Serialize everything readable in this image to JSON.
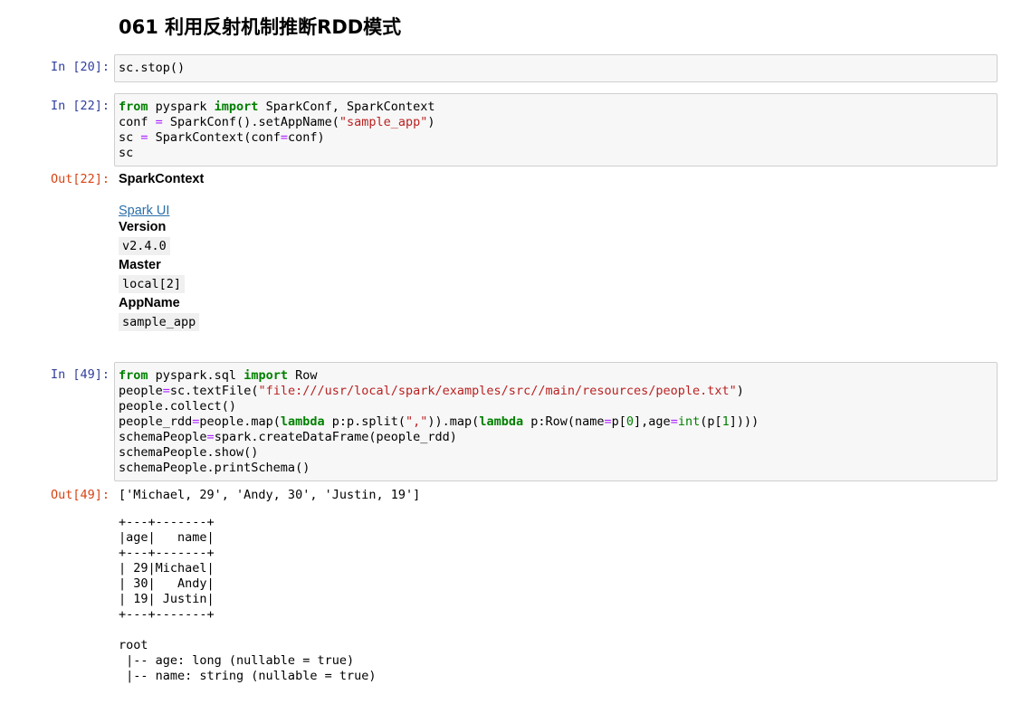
{
  "notebook": {
    "title": "061 利用反射机制推断RDD模式"
  },
  "cells": [
    {
      "prompt": "In [20]:",
      "code": "sc.stop()"
    },
    {
      "prompt": "In [22]:",
      "code_lines": [
        "from pyspark import SparkConf, SparkContext",
        "conf = SparkConf().setAppName(\"sample_app\")",
        "sc = SparkContext(conf=conf)",
        "sc"
      ],
      "out_prompt": "Out[22]:",
      "output": {
        "heading": "SparkContext",
        "link": "Spark UI",
        "version_label": "Version",
        "version_value": "v2.4.0",
        "master_label": "Master",
        "master_value": "local[2]",
        "appname_label": "AppName",
        "appname_value": "sample_app"
      }
    },
    {
      "prompt": "In [49]:",
      "code_lines": [
        "from pyspark.sql import Row",
        "people=sc.textFile(\"file:///usr/local/spark/examples/src//main/resources/people.txt\")",
        "people.collect()",
        "people_rdd=people.map(lambda p:p.split(\",\")).map(lambda p:Row(name=p[0],age=int(p[1])))",
        "schemaPeople=spark.createDataFrame(people_rdd)",
        "schemaPeople.show()",
        "schemaPeople.printSchema()"
      ],
      "out_prompt": "Out[49]:",
      "output_lines": [
        "['Michael, 29', 'Andy, 30', 'Justin, 19']",
        "",
        "+---+-------+",
        "|age|   name|",
        "+---+-------+",
        "| 29|Michael|",
        "| 30|   Andy|",
        "| 19| Justin|",
        "+---+-------+",
        "",
        "root",
        " |-- age: long (nullable = true)",
        " |-- name: string (nullable = true)"
      ]
    }
  ],
  "colors": {
    "in_prompt": "#303f9f",
    "out_prompt": "#d84315",
    "keyword": "#008000",
    "string": "#ba2121",
    "operator": "#aa22ff",
    "link": "#296eaa"
  }
}
